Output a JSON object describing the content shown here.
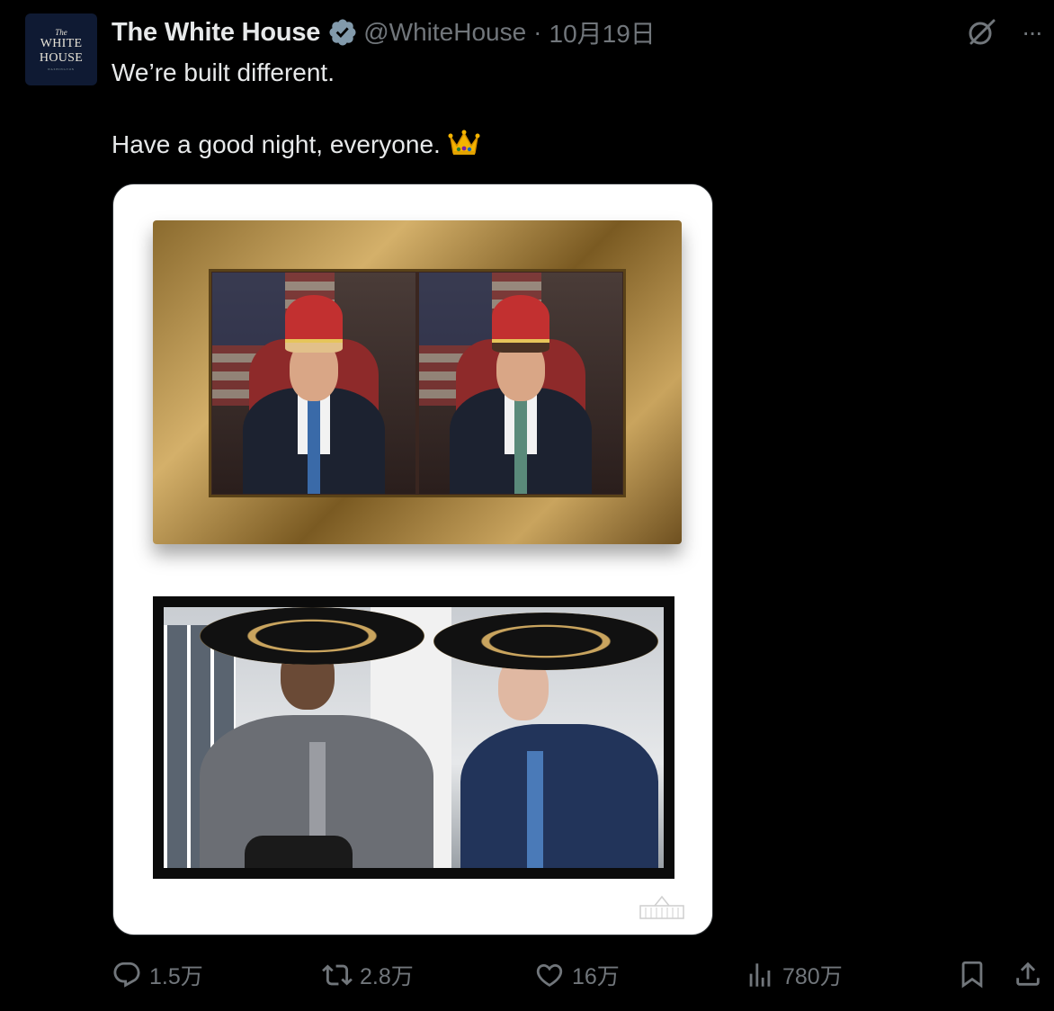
{
  "account": {
    "avatar": {
      "line1": "The",
      "line2": "WHITE",
      "line3": "HOUSE",
      "line4": "WASHINGTON"
    },
    "name": "The White House",
    "handle": "@WhiteHouse",
    "separator": "·",
    "date": "10月19日"
  },
  "post": {
    "line1": "We’re built different.",
    "line2": "Have a good night, everyone.",
    "emoji": "crown-emoji"
  },
  "icons": {
    "verified": "verified-badge-icon",
    "grok": "grok-icon",
    "more": "more-icon",
    "more_glyph": "···"
  },
  "actions": {
    "replies": "1.5万",
    "reposts": "2.8万",
    "likes": "16万",
    "views": "780万"
  },
  "colors": {
    "background": "#000000",
    "text": "#e7e9ea",
    "muted": "#71767b",
    "verified": "#829aab"
  }
}
